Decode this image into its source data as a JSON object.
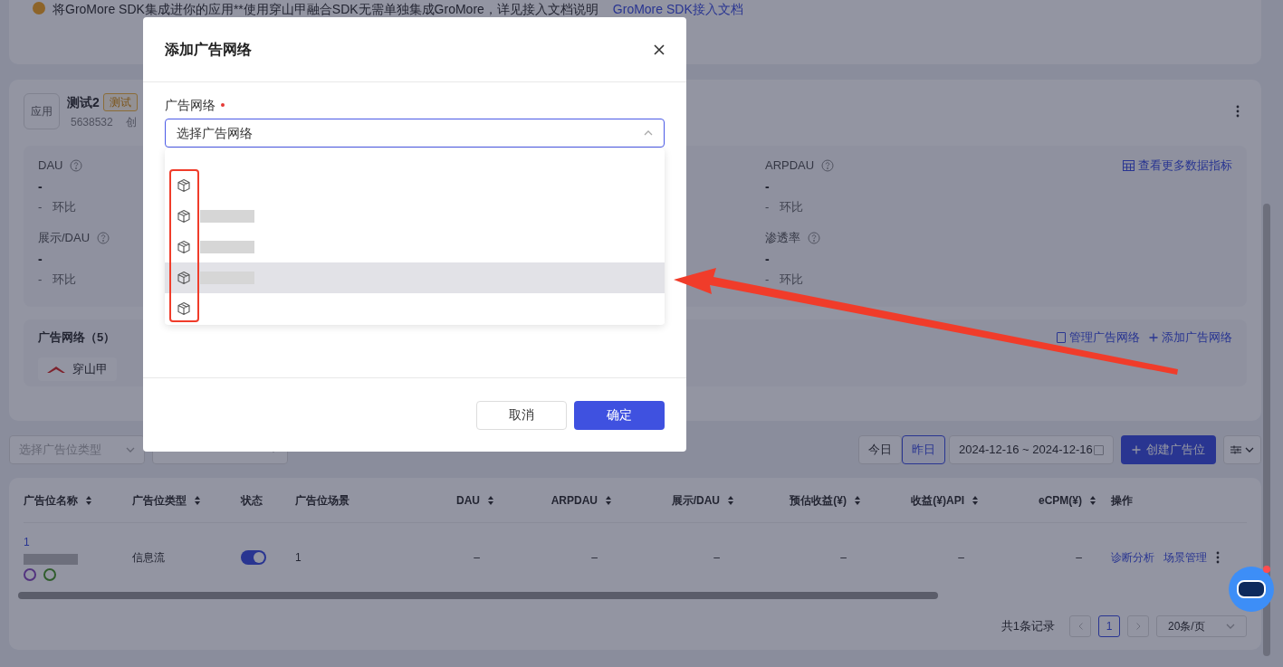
{
  "notice": {
    "text": "将GroMore SDK集成进你的应用**使用穿山甲融合SDK无需单独集成GroMore，详见接入文档说明",
    "link": "GroMore SDK接入文档"
  },
  "app": {
    "badge": "应用",
    "name": "测试2",
    "tag": "测试",
    "id": "5638532",
    "meta": "创"
  },
  "metrics_left": [
    {
      "label": "DAU",
      "value": "-",
      "change": "-",
      "change_label": "环比"
    },
    {
      "label": "展示/DAU",
      "value": "-",
      "change": "-",
      "change_label": "环比"
    }
  ],
  "metrics_right": [
    {
      "label": "ARPDAU",
      "value": "-",
      "change": "-",
      "change_label": "环比"
    },
    {
      "label": "渗透率",
      "value": "-",
      "change": "-",
      "change_label": "环比"
    }
  ],
  "more_metrics_link": "查看更多数据指标",
  "networks": {
    "title": "广告网络（5）",
    "items": [
      "穿山甲"
    ],
    "manage_link": "管理广告网络",
    "add_link": "添加广告网络"
  },
  "filters": [
    {
      "placeholder": "选择广告位类型"
    }
  ],
  "date_tabs": [
    {
      "label": "今日",
      "selected": false
    },
    {
      "label": "昨日",
      "selected": true
    }
  ],
  "date_range": "2024-12-16 ~ 2024-12-16",
  "create_button": "创建广告位",
  "table": {
    "columns": [
      {
        "label": "广告位名称",
        "sortable": true
      },
      {
        "label": "广告位类型",
        "sortable": true
      },
      {
        "label": "状态",
        "sortable": false
      },
      {
        "label": "广告位场景",
        "sortable": false
      },
      {
        "label": "DAU",
        "sortable": true
      },
      {
        "label": "ARPDAU",
        "sortable": true
      },
      {
        "label": "展示/DAU",
        "sortable": true
      },
      {
        "label": "预估收益(¥)",
        "sortable": true
      },
      {
        "label": "收益(¥)API",
        "sortable": true
      },
      {
        "label": "eCPM(¥)",
        "sortable": true
      },
      {
        "label": "操作",
        "sortable": false
      }
    ],
    "rows": [
      {
        "name": "1",
        "type": "信息流",
        "enabled": true,
        "scene": "1",
        "values": [
          "–",
          "–",
          "–",
          "–",
          "–",
          "–"
        ],
        "actions": [
          "诊断分析",
          "场景管理"
        ]
      }
    ]
  },
  "pagination": {
    "total": "共1条记录",
    "pages": [
      {
        "label": "1",
        "selected": true
      }
    ],
    "page_size": "20条/页"
  },
  "modal": {
    "title": "添加广告网络",
    "field_label": "广告网络",
    "required": true,
    "placeholder": "选择广告网络",
    "expanded": true,
    "options": [
      {
        "highlighted": false,
        "redacted": false
      },
      {
        "highlighted": false,
        "redacted": true
      },
      {
        "highlighted": false,
        "redacted": true
      },
      {
        "highlighted": true,
        "redacted": true
      },
      {
        "highlighted": false,
        "redacted": false
      }
    ],
    "buttons": [
      {
        "label": "取消",
        "kind": "secondary"
      },
      {
        "label": "确定",
        "kind": "primary"
      }
    ]
  }
}
